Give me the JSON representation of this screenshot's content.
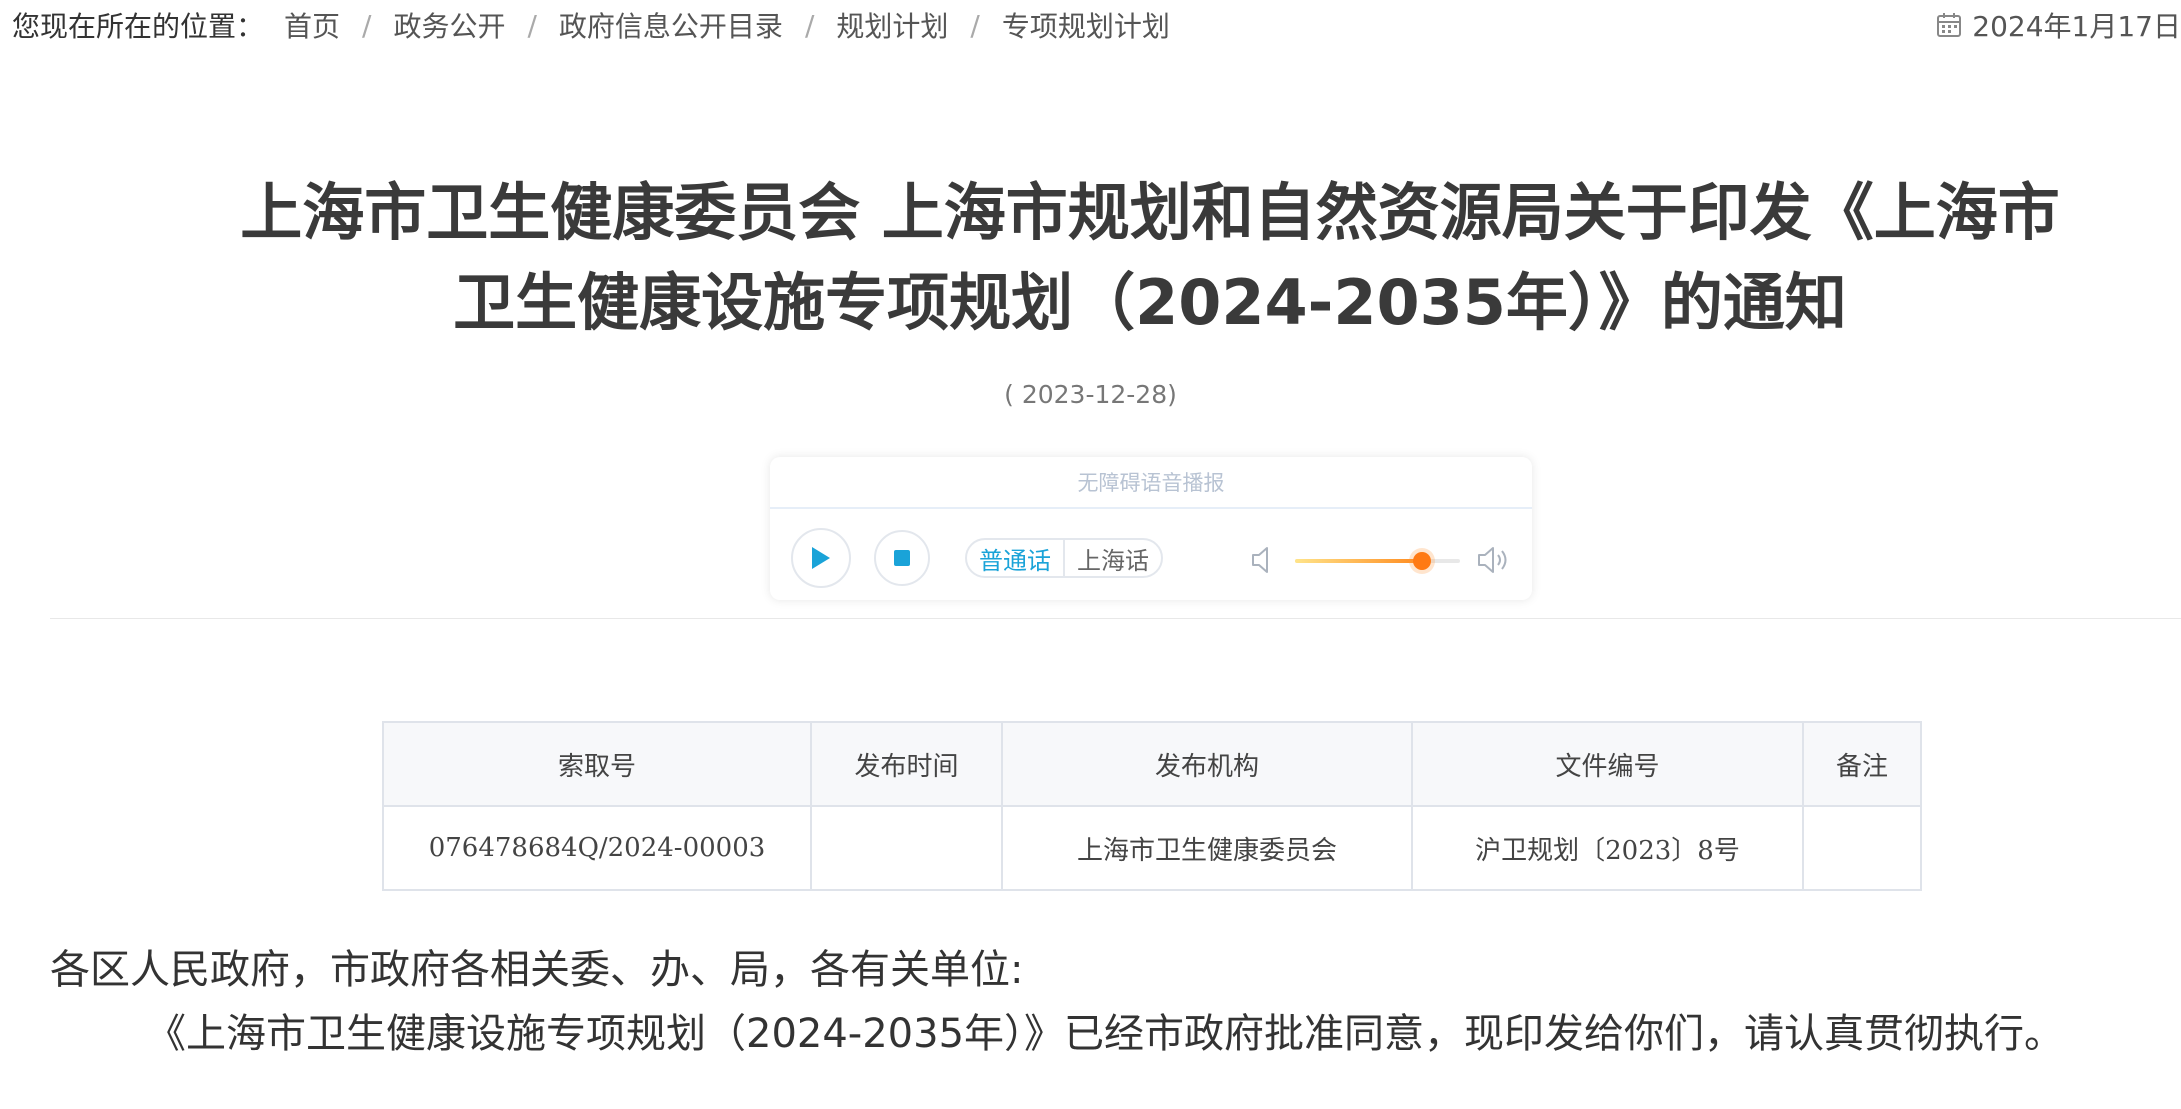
{
  "breadcrumb": {
    "prefix": "您现在所在的位置：",
    "items": [
      "首页",
      "政务公开",
      "政府信息公开目录",
      "规划计划",
      "专项规划计划"
    ],
    "separator": "/"
  },
  "header_date": "2024年1月17日 ",
  "article": {
    "title_line1": "上海市卫生健康委员会 上海市规划和自然资源局关于印发《上海市",
    "title_line2": "卫生健康设施专项规划（2024-2035年）》的通知",
    "date": "( 2023-12-28)"
  },
  "player": {
    "heading": "无障碍语音播报",
    "languages": [
      "普通话",
      "上海话"
    ],
    "active_language": "普通话",
    "volume": 0.77,
    "icons": {
      "play": "play-icon",
      "stop": "stop-icon",
      "volume_low": "volume-low-icon",
      "volume_high": "volume-high-icon"
    },
    "accent_color": "#1aa3d8",
    "volume_color": "#ff7a14"
  },
  "meta_table": {
    "headers": [
      "索取号",
      "发布时间",
      "发布机构",
      "文件编号",
      "备注"
    ],
    "row": [
      "076478684Q/2024-00003",
      "",
      "上海市卫生健康委员会",
      "沪卫规划〔2023〕8号",
      ""
    ]
  },
  "body": {
    "salutation": "各区人民政府，市政府各相关委、办、局，各有关单位:",
    "paragraph": "《上海市卫生健康设施专项规划（2024-2035年）》已经市政府批准同意，现印发给你们，请认真贯彻执行。"
  }
}
